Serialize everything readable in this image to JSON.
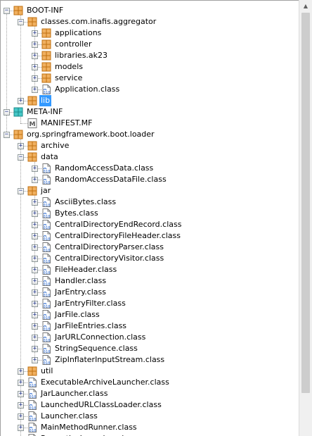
{
  "tree": {
    "rows": [
      {
        "depth": 0,
        "expander": "−",
        "icon": "package-icon",
        "label": "BOOT-INF"
      },
      {
        "depth": 1,
        "expander": "−",
        "icon": "package-icon",
        "label": "classes.com.inafis.aggregator"
      },
      {
        "depth": 2,
        "expander": "+",
        "icon": "package-icon",
        "label": "applications"
      },
      {
        "depth": 2,
        "expander": "+",
        "icon": "package-icon",
        "label": "controller"
      },
      {
        "depth": 2,
        "expander": "+",
        "icon": "package-icon",
        "label": "libraries.ak23"
      },
      {
        "depth": 2,
        "expander": "+",
        "icon": "package-icon",
        "label": "models"
      },
      {
        "depth": 2,
        "expander": "+",
        "icon": "package-icon",
        "label": "service"
      },
      {
        "depth": 2,
        "expander": "+",
        "icon": "class-file-icon",
        "label": "Application.class"
      },
      {
        "depth": 1,
        "expander": "+",
        "icon": "package-icon",
        "label": "lib",
        "selected": true
      },
      {
        "depth": 0,
        "expander": "−",
        "icon": "folder-teal-icon",
        "label": "META-INF"
      },
      {
        "depth": 1,
        "expander": "",
        "icon": "manifest-file-icon",
        "label": "MANIFEST.MF"
      },
      {
        "depth": 0,
        "expander": "−",
        "icon": "package-icon",
        "label": "org.springframework.boot.loader"
      },
      {
        "depth": 1,
        "expander": "+",
        "icon": "package-icon",
        "label": "archive"
      },
      {
        "depth": 1,
        "expander": "−",
        "icon": "package-icon",
        "label": "data"
      },
      {
        "depth": 2,
        "expander": "+",
        "icon": "class-file-icon",
        "label": "RandomAccessData.class"
      },
      {
        "depth": 2,
        "expander": "+",
        "icon": "class-file-icon",
        "label": "RandomAccessDataFile.class"
      },
      {
        "depth": 1,
        "expander": "−",
        "icon": "package-icon",
        "label": "jar"
      },
      {
        "depth": 2,
        "expander": "+",
        "icon": "class-file-icon",
        "label": "AsciiBytes.class"
      },
      {
        "depth": 2,
        "expander": "+",
        "icon": "class-file-icon",
        "label": "Bytes.class"
      },
      {
        "depth": 2,
        "expander": "+",
        "icon": "class-file-icon",
        "label": "CentralDirectoryEndRecord.class"
      },
      {
        "depth": 2,
        "expander": "+",
        "icon": "class-file-icon",
        "label": "CentralDirectoryFileHeader.class"
      },
      {
        "depth": 2,
        "expander": "+",
        "icon": "class-file-icon",
        "label": "CentralDirectoryParser.class"
      },
      {
        "depth": 2,
        "expander": "+",
        "icon": "class-file-icon",
        "label": "CentralDirectoryVisitor.class"
      },
      {
        "depth": 2,
        "expander": "+",
        "icon": "class-file-icon",
        "label": "FileHeader.class"
      },
      {
        "depth": 2,
        "expander": "+",
        "icon": "class-file-icon",
        "label": "Handler.class"
      },
      {
        "depth": 2,
        "expander": "+",
        "icon": "class-file-icon",
        "label": "JarEntry.class"
      },
      {
        "depth": 2,
        "expander": "+",
        "icon": "class-file-icon",
        "label": "JarEntryFilter.class"
      },
      {
        "depth": 2,
        "expander": "+",
        "icon": "class-file-icon",
        "label": "JarFile.class"
      },
      {
        "depth": 2,
        "expander": "+",
        "icon": "class-file-icon",
        "label": "JarFileEntries.class"
      },
      {
        "depth": 2,
        "expander": "+",
        "icon": "class-file-icon",
        "label": "JarURLConnection.class"
      },
      {
        "depth": 2,
        "expander": "+",
        "icon": "class-file-icon",
        "label": "StringSequence.class"
      },
      {
        "depth": 2,
        "expander": "+",
        "icon": "class-file-icon",
        "label": "ZipInflaterInputStream.class"
      },
      {
        "depth": 1,
        "expander": "+",
        "icon": "package-icon",
        "label": "util"
      },
      {
        "depth": 1,
        "expander": "+",
        "icon": "class-file-icon",
        "label": "ExecutableArchiveLauncher.class"
      },
      {
        "depth": 1,
        "expander": "+",
        "icon": "class-file-icon",
        "label": "JarLauncher.class"
      },
      {
        "depth": 1,
        "expander": "+",
        "icon": "class-file-icon",
        "label": "LaunchedURLClassLoader.class"
      },
      {
        "depth": 1,
        "expander": "+",
        "icon": "class-file-icon",
        "label": "Launcher.class"
      },
      {
        "depth": 1,
        "expander": "+",
        "icon": "class-file-icon",
        "label": "MainMethodRunner.class"
      },
      {
        "depth": 1,
        "expander": "+",
        "icon": "class-file-icon",
        "label": "PropertiesLauncher.class"
      }
    ]
  },
  "colors": {
    "selection": "#3399ff",
    "package_fill": "#f0b060",
    "package_stroke": "#c07010",
    "meta_fill": "#46c8c8",
    "class_accent": "#2c6ad0"
  },
  "scrollbar": {
    "up_arrow": "▲"
  }
}
